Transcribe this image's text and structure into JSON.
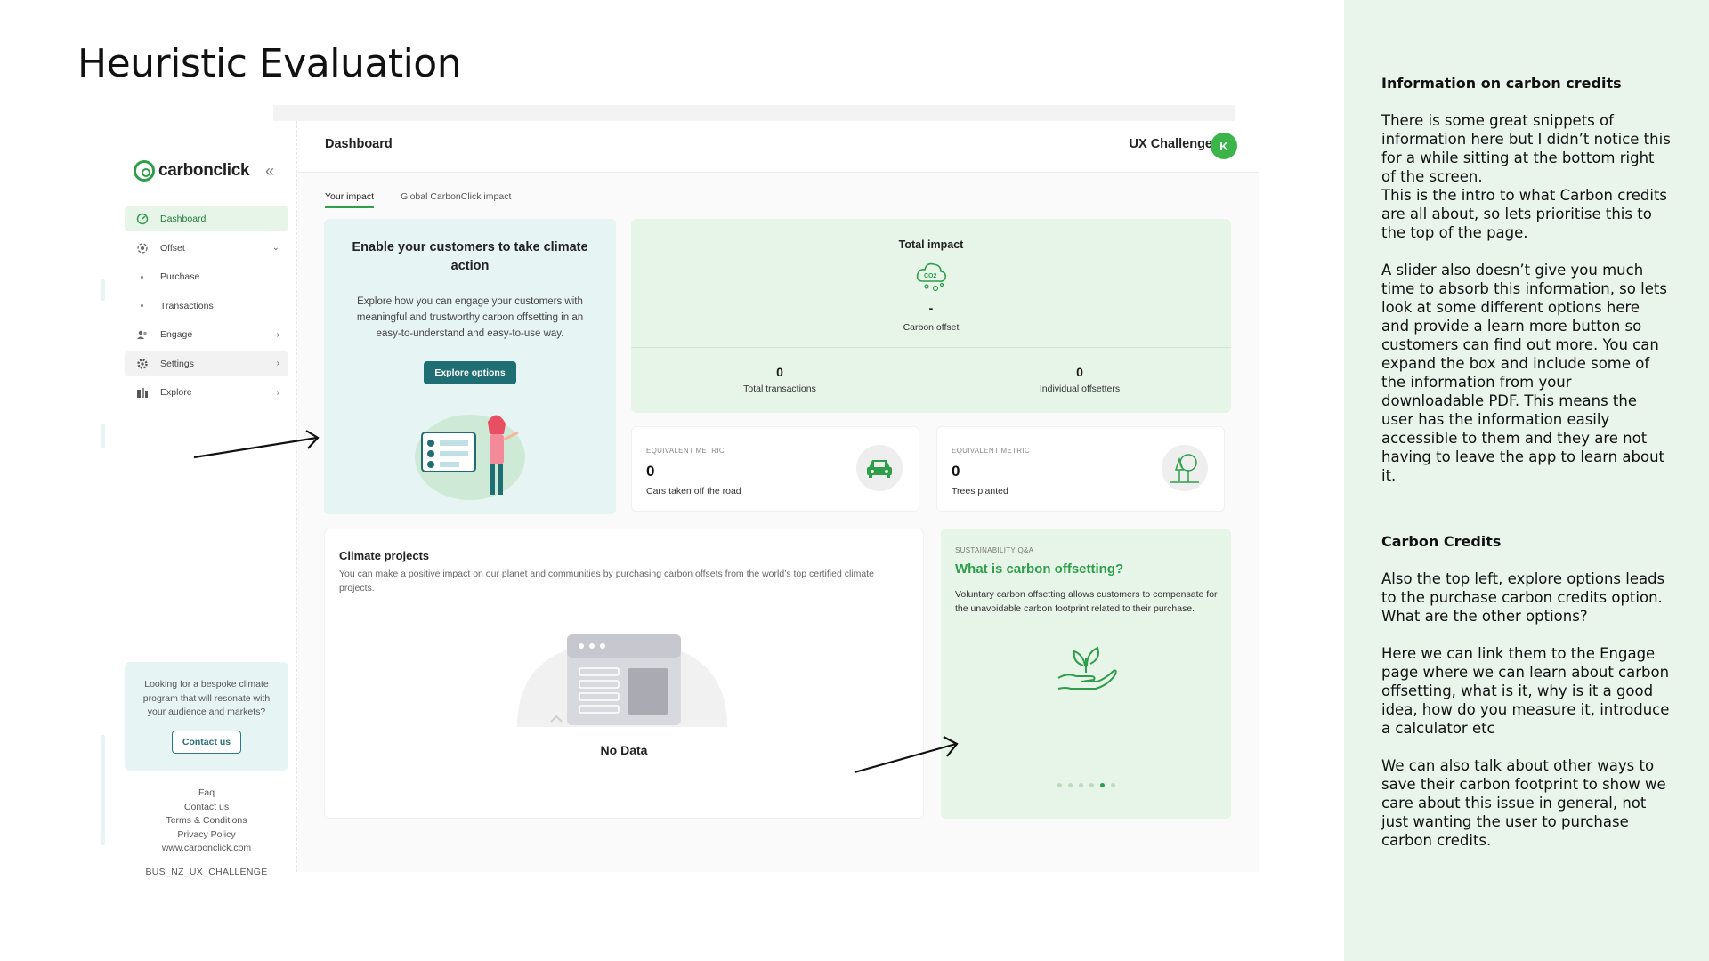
{
  "slide": {
    "title": "Heuristic Evaluation"
  },
  "notes": {
    "section1_heading": "Information on carbon credits",
    "section1_p1": "There is some great snippets of information here but I didn’t notice this for a while sitting at the bottom right of the screen.\nThis is the intro to what Carbon credits are all about, so lets prioritise this to the top of the page.",
    "section1_p2": "A slider also doesn’t give you much time to absorb this information, so lets look at some different options here and provide a learn more button so customers can find out more. You can expand the box and include some of the information from your downloadable PDF. This means the user has the information easily accessible to them and they are not having to leave the app to learn about it.",
    "section2_heading": "Carbon Credits",
    "section2_p1": "Also the top left, explore options leads to the purchase carbon credits option. What are the other options?",
    "section2_p2": "Here we can link them to the Engage page where we can learn about carbon offsetting, what is it, why is it a good idea, how do you measure it, introduce a calculator etc",
    "section2_p3": "We can also talk about other ways to save their carbon footprint to show we care about this issue in general, not just wanting the user to purchase carbon credits."
  },
  "sidebar": {
    "logo_text": "carbonclick",
    "items": [
      {
        "label": "Dashboard"
      },
      {
        "label": "Offset"
      },
      {
        "label": "Purchase"
      },
      {
        "label": "Transactions"
      },
      {
        "label": "Engage"
      },
      {
        "label": "Settings"
      },
      {
        "label": "Explore"
      }
    ],
    "bespoke_text": "Looking for a bespoke climate program that will resonate with your audience and markets?",
    "contact_label": "Contact us",
    "footer_links": [
      "Faq",
      "Contact us",
      "Terms & Conditions",
      "Privacy Policy",
      "www.carbonclick.com"
    ],
    "account_code": "BUS_NZ_UX_CHALLENGE"
  },
  "header": {
    "title": "Dashboard",
    "user_name": "UX Challenge",
    "avatar_initial": "K"
  },
  "tabs": [
    {
      "label": "Your impact"
    },
    {
      "label": "Global CarbonClick impact"
    }
  ],
  "enable_card": {
    "title": "Enable your customers to take climate action",
    "body": "Explore how you can engage your customers with meaningful and trustworthy carbon offsetting in an easy-to-understand and easy-to-use way.",
    "button": "Explore options"
  },
  "total_impact": {
    "title": "Total impact",
    "value": "-",
    "label": "Carbon offset",
    "transactions_value": "0",
    "transactions_label": "Total transactions",
    "offsetters_value": "0",
    "offsetters_label": "Individual offsetters"
  },
  "metric_cars": {
    "kicker": "EQUIVALENT METRIC",
    "value": "0",
    "label": "Cars taken off the road"
  },
  "metric_trees": {
    "kicker": "EQUIVALENT METRIC",
    "value": "0",
    "label": "Trees planted"
  },
  "climate_projects": {
    "title": "Climate projects",
    "body": "You can make a positive impact on our planet and communities by purchasing carbon offsets from the world’s top certified climate projects.",
    "empty": "No Data"
  },
  "qa_card": {
    "kicker": "SUSTAINABILITY Q&A",
    "title": "What is carbon offsetting?",
    "body": "Voluntary carbon offsetting allows customers to compensate for the unavoidable carbon footprint related to their purchase.",
    "slides_total": 6,
    "slide_active_index": 4
  },
  "colors": {
    "brand_green": "#2e9e4a",
    "teal_button": "#1e6e74",
    "panel_green": "#e9f5ea"
  }
}
